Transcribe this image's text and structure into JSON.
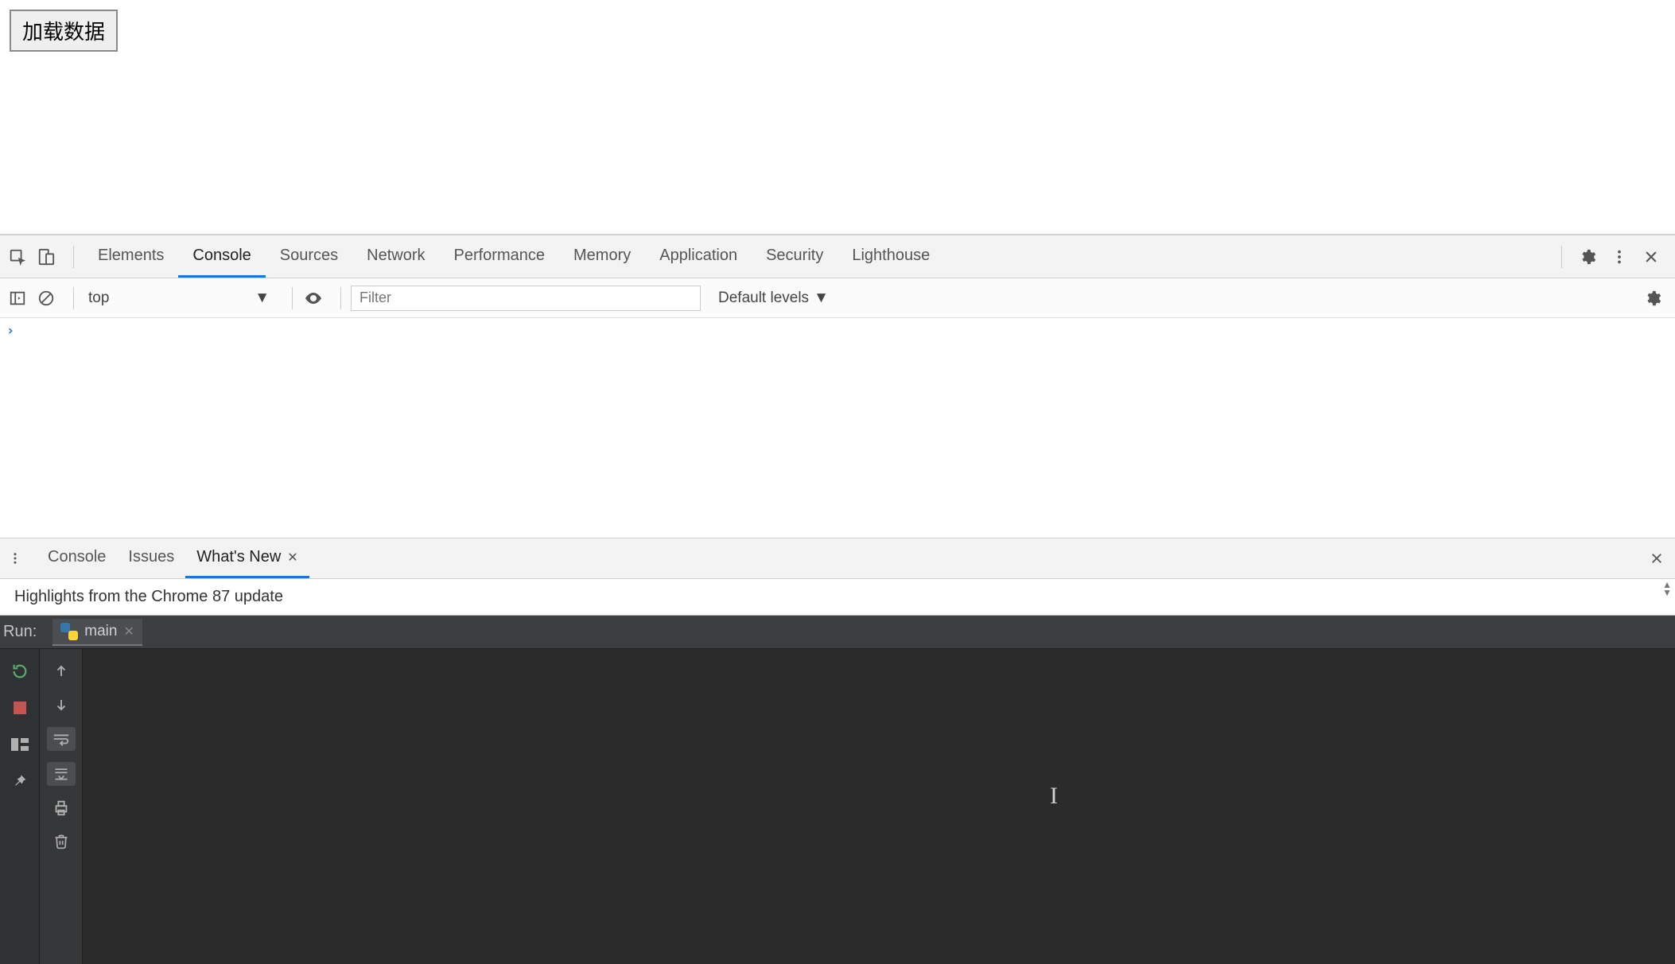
{
  "page": {
    "load_button_label": "加载数据"
  },
  "devtools": {
    "tabs": [
      "Elements",
      "Console",
      "Sources",
      "Network",
      "Performance",
      "Memory",
      "Application",
      "Security",
      "Lighthouse"
    ],
    "active_tab_index": 1,
    "context": "top",
    "filter_placeholder": "Filter",
    "levels_label": "Default levels"
  },
  "drawer": {
    "tabs": [
      "Console",
      "Issues",
      "What's New"
    ],
    "active_tab_index": 2,
    "highlights_text": "Highlights from the Chrome 87 update"
  },
  "ide": {
    "run_label": "Run:",
    "file_tab_label": "main"
  }
}
